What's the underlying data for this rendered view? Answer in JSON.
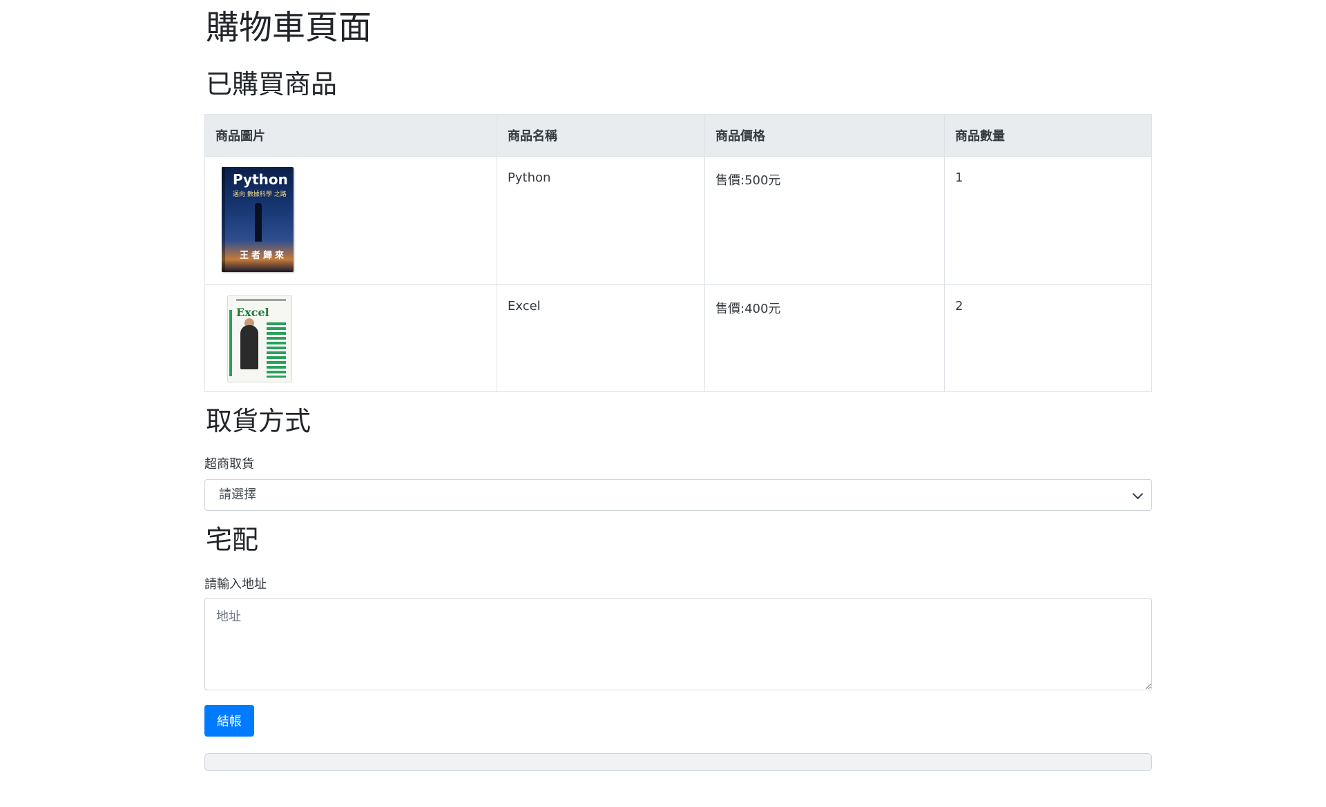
{
  "page": {
    "title": "購物車頁面"
  },
  "cart": {
    "section_title": "已購買商品",
    "columns": [
      "商品圖片",
      "商品名稱",
      "商品價格",
      "商品數量"
    ],
    "items": [
      {
        "image_icon": "python-book-cover",
        "cover_title": "Python",
        "cover_subtitle": "邁向 數據科學 之路",
        "cover_bottom": "王者歸來",
        "name": "Python",
        "price": "售價:500元",
        "quantity": "1"
      },
      {
        "image_icon": "excel-book-cover",
        "cover_title": "Excel",
        "name": "Excel",
        "price": "售價:400元",
        "quantity": "2"
      }
    ]
  },
  "pickup": {
    "section_title": "取貨方式",
    "store_label": "超商取貨",
    "store_select_value": "請選擇"
  },
  "delivery": {
    "section_title": "宅配",
    "address_label": "請輸入地址",
    "address_placeholder": "地址"
  },
  "actions": {
    "checkout_label": "結帳"
  },
  "colors": {
    "primary": "#007bff",
    "table_header_bg": "#e9ecef",
    "border": "#dee2e6"
  }
}
